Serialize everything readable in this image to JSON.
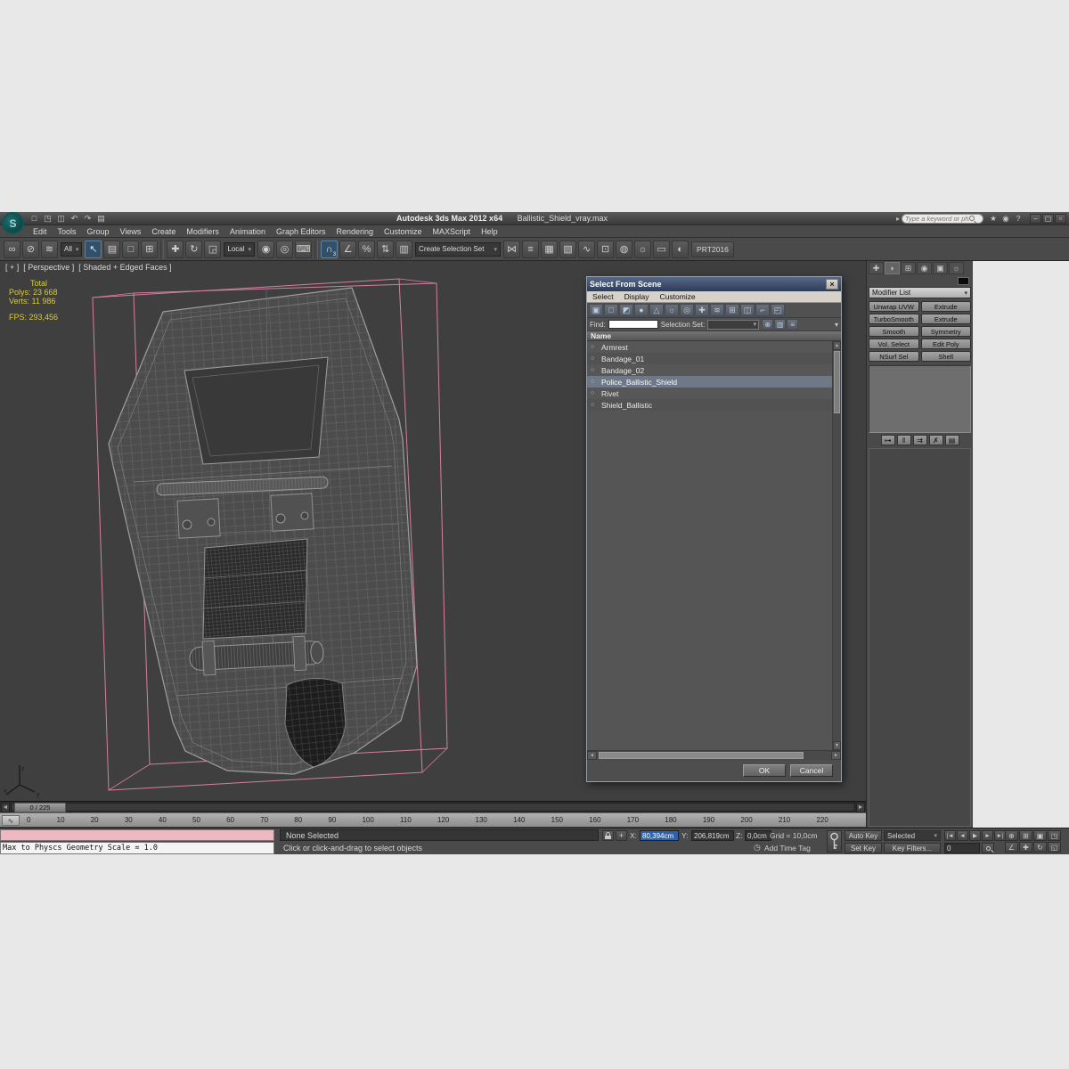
{
  "titlebar": {
    "app_title": "Autodesk 3ds Max 2012 x64",
    "file_name": "Ballistic_Shield_vray.max",
    "search_placeholder": "Type a keyword or phrase",
    "search_arrow": "▸",
    "logo_letter": "S",
    "quick_access": [
      {
        "name": "new-scene-icon",
        "glyph": "□"
      },
      {
        "name": "open-file-icon",
        "glyph": "◳"
      },
      {
        "name": "save-file-icon",
        "glyph": "◫"
      },
      {
        "name": "undo-icon",
        "glyph": "↶"
      },
      {
        "name": "redo-icon",
        "glyph": "↷"
      },
      {
        "name": "project-folder-icon",
        "glyph": "▤"
      }
    ],
    "right_icons": [
      {
        "name": "infocenter-star-icon",
        "glyph": "★"
      },
      {
        "name": "communication-center-icon",
        "glyph": "◉"
      },
      {
        "name": "help-icon",
        "glyph": "?"
      }
    ],
    "window_controls": [
      {
        "name": "minimize-button",
        "glyph": "–"
      },
      {
        "name": "maximize-button",
        "glyph": "▢"
      },
      {
        "name": "close-button",
        "glyph": "×"
      }
    ]
  },
  "menus": [
    "Edit",
    "Tools",
    "Group",
    "Views",
    "Create",
    "Modifiers",
    "Animation",
    "Graph Editors",
    "Rendering",
    "Customize",
    "MAXScript",
    "Help"
  ],
  "toolbar": {
    "items": [
      {
        "t": "icon",
        "name": "select-and-link-icon",
        "g": "∞"
      },
      {
        "t": "icon",
        "name": "unlink-selection-icon",
        "g": "⊘"
      },
      {
        "t": "icon",
        "name": "bind-to-space-warp-icon",
        "g": "≋"
      },
      {
        "t": "dd",
        "name": "selection-filter-dropdown",
        "label": "All"
      },
      {
        "t": "icon",
        "name": "select-object-icon",
        "g": "↖",
        "active": true
      },
      {
        "t": "icon",
        "name": "select-by-name-icon",
        "g": "▤"
      },
      {
        "t": "icon",
        "name": "rectangular-selection-icon",
        "g": "□"
      },
      {
        "t": "icon",
        "name": "window-crossing-icon",
        "g": "⊞"
      },
      {
        "t": "sep"
      },
      {
        "t": "icon",
        "name": "select-and-move-icon",
        "g": "✚"
      },
      {
        "t": "icon",
        "name": "select-and-rotate-icon",
        "g": "↻"
      },
      {
        "t": "icon",
        "name": "select-and-scale-icon",
        "g": "◲"
      },
      {
        "t": "dd",
        "name": "coordinate-system-dropdown",
        "label": "Local"
      },
      {
        "t": "icon",
        "name": "use-pivot-center-icon",
        "g": "◉"
      },
      {
        "t": "icon",
        "name": "select-and-manipulate-icon",
        "g": "◎"
      },
      {
        "t": "icon",
        "name": "keyboard-override-icon",
        "g": "⌨"
      },
      {
        "t": "sep"
      },
      {
        "t": "icon",
        "name": "snaps-toggle-icon",
        "g": "∩",
        "sup": "3",
        "active": true
      },
      {
        "t": "icon",
        "name": "angle-snap-icon",
        "g": "∠"
      },
      {
        "t": "icon",
        "name": "percent-snap-icon",
        "g": "%"
      },
      {
        "t": "icon",
        "name": "spinner-snap-icon",
        "g": "⇅"
      },
      {
        "t": "icon",
        "name": "named-selection-sets-icon",
        "g": "▥"
      },
      {
        "t": "combo",
        "name": "selection-set-combo",
        "label": "Create Selection Set"
      },
      {
        "t": "icon",
        "name": "mirror-icon",
        "g": "⋈"
      },
      {
        "t": "icon",
        "name": "align-icon",
        "g": "≡"
      },
      {
        "t": "icon",
        "name": "layer-manager-icon",
        "g": "▦"
      },
      {
        "t": "icon",
        "name": "graphite-ribbon-icon",
        "g": "▧"
      },
      {
        "t": "icon",
        "name": "curve-editor-icon",
        "g": "∿"
      },
      {
        "t": "icon",
        "name": "schematic-view-icon",
        "g": "⊡"
      },
      {
        "t": "icon",
        "name": "material-editor-icon",
        "g": "◍"
      },
      {
        "t": "icon",
        "name": "render-setup-icon",
        "g": "☼"
      },
      {
        "t": "icon",
        "name": "rendered-frame-icon",
        "g": "▭"
      },
      {
        "t": "icon",
        "name": "render-production-icon",
        "g": "◐"
      },
      {
        "t": "label",
        "name": "prt2016-button",
        "label": "PRT2016"
      }
    ]
  },
  "viewport": {
    "label_plus": "[ + ]",
    "label_view": "[ Perspective ]",
    "label_shading": "[ Shaded + Edged Faces ]",
    "stats": {
      "total_label": "Total",
      "polys": "Polys: 23 668",
      "verts": "Verts: 11 986",
      "fps": "FPS: 293,456"
    }
  },
  "dialog": {
    "title": "Select From Scene",
    "menus": [
      "Select",
      "Display",
      "Customize"
    ],
    "toolbar_icons": [
      {
        "name": "display-all-icon",
        "glyph": "▣"
      },
      {
        "name": "display-none-icon",
        "glyph": "□"
      },
      {
        "name": "display-invert-icon",
        "glyph": "◩"
      },
      {
        "name": "display-geometry-icon",
        "glyph": "●"
      },
      {
        "name": "display-shapes-icon",
        "glyph": "△"
      },
      {
        "name": "display-lights-icon",
        "glyph": "☼"
      },
      {
        "name": "display-cameras-icon",
        "glyph": "◎"
      },
      {
        "name": "display-helpers-icon",
        "glyph": "✚"
      },
      {
        "name": "display-spacewarps-icon",
        "glyph": "≋"
      },
      {
        "name": "display-groups-icon",
        "glyph": "⊞"
      },
      {
        "name": "display-xrefs-icon",
        "glyph": "◫"
      },
      {
        "name": "display-bones-icon",
        "glyph": "⌐"
      },
      {
        "name": "display-containers-icon",
        "glyph": "◰"
      }
    ],
    "find_label": "Find:",
    "selection_set_label": "Selection Set:",
    "find_icons": [
      {
        "name": "create-selection-set-icon",
        "glyph": "⊕"
      },
      {
        "name": "column-chooser-icon",
        "glyph": "▥"
      },
      {
        "name": "configure-columns-icon",
        "glyph": "≡"
      }
    ],
    "overflow_glyph": "▾",
    "column_header": "Name",
    "items": [
      {
        "label": "Armrest",
        "selected": false
      },
      {
        "label": "Bandage_01",
        "selected": false
      },
      {
        "label": "Bandage_02",
        "selected": false
      },
      {
        "label": "Police_Ballistic_Shield",
        "selected": true
      },
      {
        "label": "Rivet",
        "selected": false
      },
      {
        "label": "Shield_Ballistic",
        "selected": false
      }
    ],
    "ok_label": "OK",
    "cancel_label": "Cancel"
  },
  "command_panel": {
    "tabs": [
      {
        "name": "create-tab",
        "glyph": "✚"
      },
      {
        "name": "modify-tab",
        "glyph": "◗",
        "active": true
      },
      {
        "name": "hierarchy-tab",
        "glyph": "⊞"
      },
      {
        "name": "motion-tab",
        "glyph": "◉"
      },
      {
        "name": "display-tab",
        "glyph": "▣"
      },
      {
        "name": "utilities-tab",
        "glyph": "☼"
      }
    ],
    "modifier_list_label": "Modifier List",
    "modifier_buttons": [
      "Unwrap UVW",
      "Extrude",
      "TurboSmooth",
      "Extrude",
      "Smooth",
      "Symmetry",
      "Vol. Select",
      "Edit Poly",
      "NSurf Sel",
      "Shell"
    ],
    "stack_tools": [
      {
        "name": "pin-stack-icon",
        "glyph": "⊶"
      },
      {
        "name": "show-end-result-icon",
        "glyph": "‖"
      },
      {
        "name": "make-unique-icon",
        "glyph": "⇉"
      },
      {
        "name": "remove-modifier-icon",
        "glyph": "✗"
      },
      {
        "name": "configure-modifier-sets-icon",
        "glyph": "▤"
      }
    ]
  },
  "timeline": {
    "slider_label": "0 / 225",
    "ticks": [
      "0",
      "10",
      "20",
      "30",
      "40",
      "50",
      "60",
      "70",
      "80",
      "90",
      "100",
      "110",
      "120",
      "130",
      "140",
      "150",
      "160",
      "170",
      "180",
      "190",
      "200",
      "210",
      "220"
    ]
  },
  "status": {
    "listener_text": "Max to Physcs Geometry Scale = 1.0",
    "status_line": "None Selected",
    "prompt_line": "Click or click-and-drag to select objects",
    "x_label": "X:",
    "x_value": "80,394cm",
    "y_label": "Y:",
    "y_value": "206,819cm",
    "z_label": "Z:",
    "z_value": "0,0cm",
    "grid_label": "Grid = 10,0cm",
    "add_time_tag": "Add Time Tag",
    "auto_key": "Auto Key",
    "set_key": "Set Key",
    "selected_dropdown": "Selected",
    "key_filters": "Key Filters...",
    "frame_field": "0",
    "transport": [
      {
        "name": "go-to-start-button",
        "glyph": "|◄"
      },
      {
        "name": "previous-frame-button",
        "glyph": "◄"
      },
      {
        "name": "play-animation-button",
        "glyph": "▶"
      },
      {
        "name": "next-frame-button",
        "glyph": "►"
      },
      {
        "name": "go-to-end-button",
        "glyph": "►|"
      }
    ],
    "nav_icons": [
      {
        "name": "zoom-icon",
        "glyph": "⊕"
      },
      {
        "name": "zoom-all-icon",
        "glyph": "⊞"
      },
      {
        "name": "zoom-extents-icon",
        "glyph": "▣"
      },
      {
        "name": "zoom-region-icon",
        "glyph": "◳"
      },
      {
        "name": "field-of-view-icon",
        "glyph": "∠"
      },
      {
        "name": "pan-icon",
        "glyph": "✚"
      },
      {
        "name": "orbit-icon",
        "glyph": "↻"
      },
      {
        "name": "maximize-viewport-icon",
        "glyph": "◱"
      }
    ]
  }
}
